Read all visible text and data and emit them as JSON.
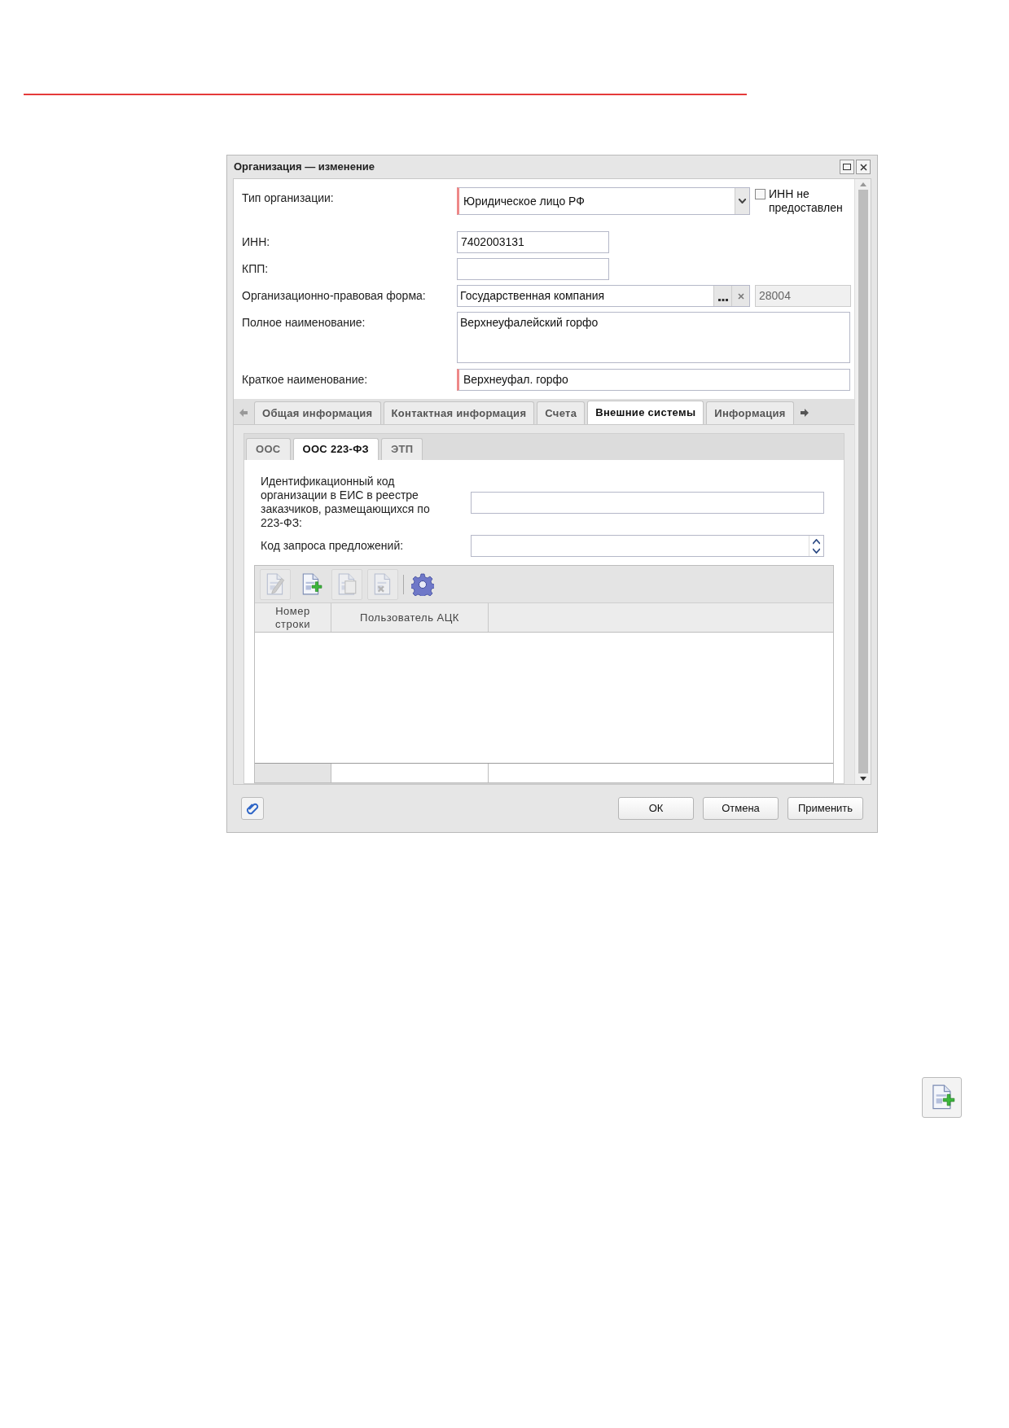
{
  "window": {
    "title": "Организация — изменение"
  },
  "fields": [
    {
      "kind": "combo",
      "label": "Тип организации:",
      "value": "Юридическое лицо РФ",
      "required": true
    },
    {
      "kind": "text",
      "label": "ИНН:",
      "value": "7402003131",
      "required": false
    },
    {
      "kind": "text",
      "label": "КПП:",
      "required": false
    },
    {
      "kind": "lookup",
      "label": "Организационно-правовая форма:",
      "value": "Государственная компания",
      "code": "28004",
      "required": false
    },
    {
      "kind": "area",
      "label": "Полное наименование:",
      "value": "Верхнеуфалейский горфо",
      "required": false
    },
    {
      "kind": "wide",
      "label": "Краткое наименование:",
      "value": "Верхнеуфал. горфо",
      "required": true
    }
  ],
  "inn_checkbox": {
    "label": "ИНН не предоставлен",
    "checked": false
  },
  "tabs": [
    {
      "label": "Общая информация",
      "selected": false
    },
    {
      "label": "Контактная информация",
      "selected": false
    },
    {
      "label": "Счета",
      "selected": false
    },
    {
      "label": "Внешние системы",
      "selected": true
    },
    {
      "label": "Информация",
      "selected": false
    }
  ],
  "subtabs": [
    {
      "label": "ООС",
      "selected": false
    },
    {
      "label": "ООС 223-ФЗ",
      "selected": true
    },
    {
      "label": "ЭТП",
      "selected": false
    }
  ],
  "ext_fields": [
    {
      "kind": "text",
      "label": "Идентификационный код организации в ЕИС в реестре заказчиков, размещающихся по 223-ФЗ:"
    },
    {
      "kind": "spinner",
      "label": "Код запроса предложений:"
    }
  ],
  "toolbar": [
    {
      "kind": "edit",
      "disabled": true
    },
    {
      "kind": "add",
      "disabled": false
    },
    {
      "kind": "copy",
      "disabled": true
    },
    {
      "kind": "delete",
      "disabled": true
    },
    {
      "kind": "settings",
      "disabled": false
    }
  ],
  "table": {
    "columns": [
      "Номер строки",
      "Пользователь АЦК"
    ]
  },
  "buttons": [
    "ОК",
    "Отмена",
    "Применить"
  ]
}
